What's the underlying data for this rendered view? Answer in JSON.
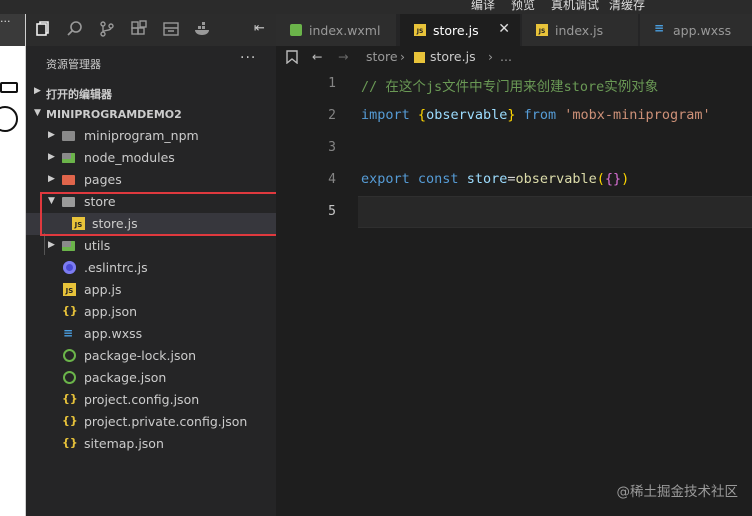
{
  "menu": {
    "items": [
      "编译",
      "预览",
      "真机调试",
      "清缓存"
    ]
  },
  "simulator": {
    "nav_text": "..."
  },
  "explorer": {
    "title": "资源管理器",
    "more": "···",
    "sections": {
      "open_editors": "打开的编辑器",
      "project": "MINIPROGRAMDEMO2"
    },
    "items": [
      {
        "name": "miniprogram_npm",
        "kind": "folder",
        "icon": "folder-icon"
      },
      {
        "name": "node_modules",
        "kind": "folder",
        "icon": "folder-node-icon"
      },
      {
        "name": "pages",
        "kind": "folder",
        "icon": "folder-pages-icon"
      },
      {
        "name": "store",
        "kind": "folder-open",
        "icon": "folder-open-icon"
      },
      {
        "name": "store.js",
        "kind": "js",
        "icon": "js-file-icon"
      },
      {
        "name": "utils",
        "kind": "folder",
        "icon": "folder-utils-icon"
      },
      {
        "name": ".eslintrc.js",
        "kind": "eslint",
        "icon": "eslint-icon"
      },
      {
        "name": "app.js",
        "kind": "js",
        "icon": "js-file-icon"
      },
      {
        "name": "app.json",
        "kind": "json",
        "icon": "json-icon"
      },
      {
        "name": "app.wxss",
        "kind": "css",
        "icon": "css-icon"
      },
      {
        "name": "package-lock.json",
        "kind": "npm",
        "icon": "npm-icon"
      },
      {
        "name": "package.json",
        "kind": "npm",
        "icon": "npm-icon"
      },
      {
        "name": "project.config.json",
        "kind": "json",
        "icon": "json-icon"
      },
      {
        "name": "project.private.config.json",
        "kind": "json",
        "icon": "json-icon"
      },
      {
        "name": "sitemap.json",
        "kind": "json",
        "icon": "json-icon"
      }
    ]
  },
  "tabs": [
    {
      "label": "index.wxml",
      "icon": "wxml-icon",
      "active": false
    },
    {
      "label": "store.js",
      "icon": "js-file-icon",
      "active": true,
      "close": "✕"
    },
    {
      "label": "index.js",
      "icon": "js-file-icon",
      "active": false
    },
    {
      "label": "app.wxss",
      "icon": "css-icon",
      "active": false
    }
  ],
  "breadcrumb": {
    "folder": "store",
    "sep1": "›",
    "file": "store.js",
    "sep2": "›",
    "more": "..."
  },
  "editor": {
    "line_numbers": [
      "1",
      "2",
      "3",
      "4",
      "5"
    ],
    "comment": "// 在这个js文件中专门用来创建store实例对象",
    "line2": {
      "kw_import": "import",
      "brace_open": "{",
      "ident": "observable",
      "brace_close": "}",
      "kw_from": "from",
      "str": "'mobx-miniprogram'"
    },
    "line4": {
      "kw_export": "export",
      "kw_const": "const",
      "ident": "store",
      "eq": "=",
      "fn": "observable",
      "paren_open": "(",
      "obj": "{}",
      "paren_close": ")"
    }
  },
  "watermark": "@稀土掘金技术社区",
  "colors": {
    "highlight_box": "#e0393e",
    "comment": "#6a9955",
    "keyword": "#569cd6",
    "string": "#ce9178"
  }
}
